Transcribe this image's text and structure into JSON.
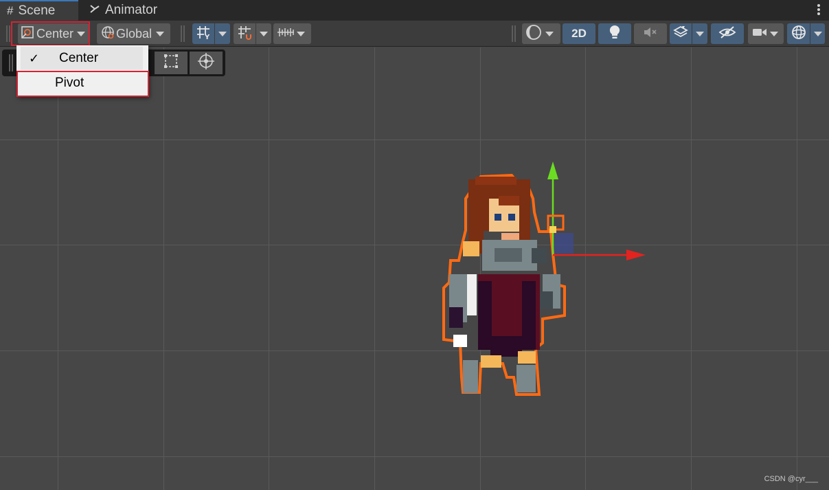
{
  "tabs": [
    {
      "label": "Scene",
      "icon": "hash-icon"
    },
    {
      "label": "Animator",
      "icon": "animator-icon"
    }
  ],
  "toolbar": {
    "pivot_mode": "Center",
    "space_mode": "Global",
    "toggle_2d": "2D"
  },
  "pivot_menu": {
    "items": [
      {
        "label": "Center",
        "checked": true
      },
      {
        "label": "Pivot",
        "checked": false
      }
    ]
  },
  "watermark": "CSDN @cyr___",
  "colors": {
    "highlight": "#d42332",
    "selection_outline": "#ff6a13",
    "axis_x": "#e3231f",
    "axis_y": "#6bdc22",
    "toggle_active": "#46607c"
  }
}
